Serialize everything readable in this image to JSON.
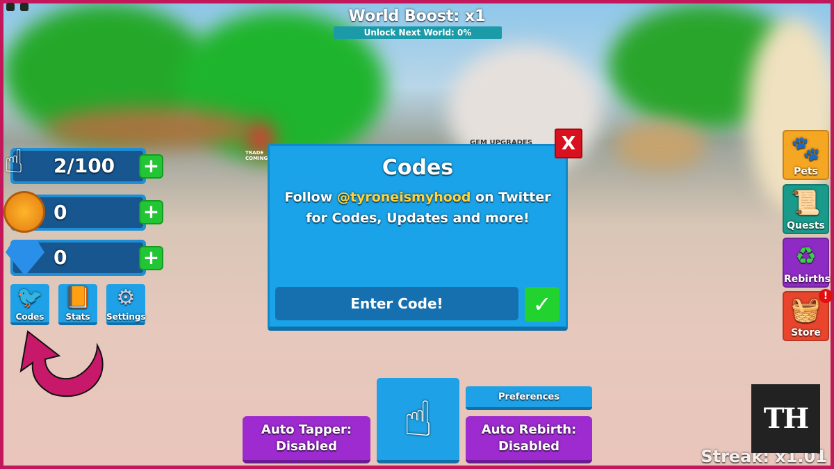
{
  "hud": {
    "world_boost": "World Boost: x1",
    "unlock_next": "Unlock Next World: 0%",
    "unlock_progress": 0
  },
  "stats": [
    {
      "icon": "hand-pointer-icon",
      "value": "2/100"
    },
    {
      "icon": "coin-icon",
      "value": "0"
    },
    {
      "icon": "gem-icon",
      "value": "0"
    }
  ],
  "side_buttons": [
    {
      "icon": "twitter-bird-icon",
      "label": "Codes"
    },
    {
      "icon": "book-icon",
      "label": "Stats"
    },
    {
      "icon": "gear-icon",
      "label": "Settings"
    }
  ],
  "right_menu": [
    {
      "icon": "paw-icon",
      "label": "Pets",
      "color": "#f5a623"
    },
    {
      "icon": "scroll-icon",
      "label": "Quests",
      "color": "#1a9a8a"
    },
    {
      "icon": "recycle-icon",
      "label": "Rebirths",
      "color": "#8e2bc4"
    },
    {
      "icon": "basket-icon",
      "label": "Store",
      "color": "#e8452c",
      "badge": "!"
    }
  ],
  "modal": {
    "title": "Codes",
    "line1_pre": "Follow ",
    "handle": "@tyroneismyhood",
    "line1_post": " on Twitter",
    "line2": "for Codes, Updates and more!",
    "input_placeholder": "Enter Code!",
    "close": "X",
    "submit": "✓"
  },
  "bottom": {
    "auto_tapper": "Auto Tapper:",
    "auto_tapper_state": "Disabled",
    "preferences": "Preferences",
    "auto_rebirth": "Auto Rebirth:",
    "auto_rebirth_state": "Disabled"
  },
  "streak": "Streak: x1.01",
  "world_signs": {
    "trade": "TRADE",
    "coming": "COMING SOON",
    "gem_upgrades": "GEM UPGRADES"
  },
  "watermark": "TH",
  "colors": {
    "border": "#c2185b",
    "modal": "#1aa3e8",
    "accent_yellow": "#ffd23c",
    "green": "#22c634",
    "purple": "#9d2bd0"
  }
}
